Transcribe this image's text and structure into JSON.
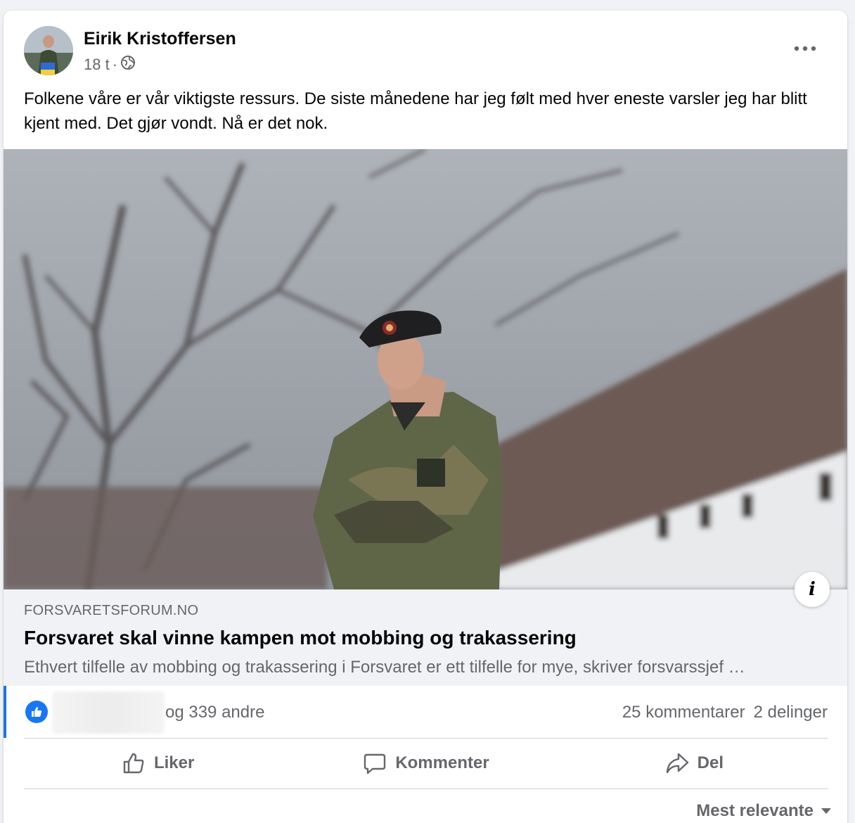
{
  "post": {
    "author": "Eirik Kristoffersen",
    "time": "18 t",
    "separator": "·",
    "privacy_icon": "globe-icon",
    "text": "Folkene våre er vår viktigste ressurs. De siste månedene har jeg følt med hver eneste varsler jeg har blitt kjent med. Det gjør vondt. Nå er det nok."
  },
  "link": {
    "domain": "FORSVARETSFORUM.NO",
    "title": "Forsvaret skal vinne kampen mot mobbing og trakassering",
    "description": "Ethvert tilfelle av mobbing og trakassering i Forsvaret er ett tilfelle for mye, skriver forsvarssjef …",
    "info_icon_glyph": "i"
  },
  "reactions": {
    "likes_text": "og 339 andre",
    "comments": "25 kommentarer",
    "shares": "2 delinger"
  },
  "actions": {
    "like": "Liker",
    "comment": "Kommenter",
    "share": "Del"
  },
  "comments_sort": {
    "label": "Mest relevante"
  },
  "colors": {
    "accent": "#1877f2",
    "secondary_text": "#65676b",
    "background": "#f0f2f5"
  }
}
